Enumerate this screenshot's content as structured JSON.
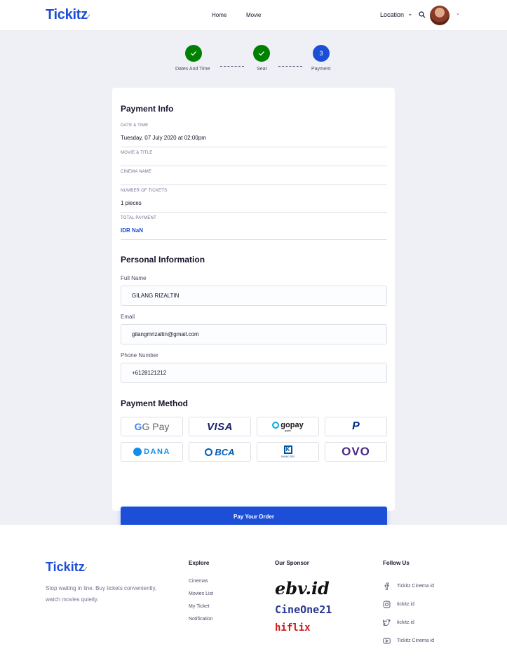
{
  "header": {
    "logo": "Tickitz",
    "nav": [
      "Home",
      "Movie"
    ],
    "location": "Location"
  },
  "stepper": [
    {
      "label": "Dates And Time",
      "state": "done"
    },
    {
      "label": "Seat",
      "state": "done"
    },
    {
      "label": "Payment",
      "state": "active",
      "number": "3"
    }
  ],
  "payment_info": {
    "title": "Payment Info",
    "rows": [
      {
        "label": "DATE & TIME",
        "value": "Tuesday, 07 July 2020 at 02:00pm"
      },
      {
        "label": "MOVIE & TITLE",
        "value": ""
      },
      {
        "label": "CINEMA NAME",
        "value": ""
      },
      {
        "label": "NUMBER OF TICKETS",
        "value": "1 pieces"
      },
      {
        "label": "TOTAL PAYMENT",
        "value": "IDR NaN"
      }
    ]
  },
  "personal": {
    "title": "Personal Information",
    "fields": [
      {
        "label": "Full Name",
        "value": "GILANG RIZALTIN"
      },
      {
        "label": "Email",
        "value": "gilangmrizaltin@gmail.com"
      },
      {
        "label": "Phone Number",
        "value": "+6128121212"
      }
    ]
  },
  "payment_method": {
    "title": "Payment Method",
    "options": [
      "G Pay",
      "VISA",
      "gopay",
      "PayPal",
      "DANA",
      "BCA",
      "BANK BRI",
      "OVO"
    ],
    "gopay_sub": "gojek",
    "button": "Pay Your Order"
  },
  "footer": {
    "logo": "Tickitz",
    "tagline": "Stop waiting in line. Buy tickets conveniently, watch movies quietly.",
    "explore_title": "Explore",
    "explore": [
      "Cinemas",
      "Movies List",
      "My Ticket",
      "Notification"
    ],
    "sponsor_title": "Our Sponsor",
    "sponsors": [
      "ebv.id",
      "CineOne21",
      "hiflix"
    ],
    "follow_title": "Follow Us",
    "social": [
      {
        "icon": "facebook-icon",
        "label": "Tickitz Cinema id"
      },
      {
        "icon": "instagram-icon",
        "label": "tickitz.id"
      },
      {
        "icon": "twitter-icon",
        "label": "tickitz.id"
      },
      {
        "icon": "youtube-icon",
        "label": "Tickitz Cinema id"
      }
    ]
  },
  "colors": {
    "primary": "#1d4ed8",
    "done": "#008000",
    "background": "#eff0f6"
  }
}
